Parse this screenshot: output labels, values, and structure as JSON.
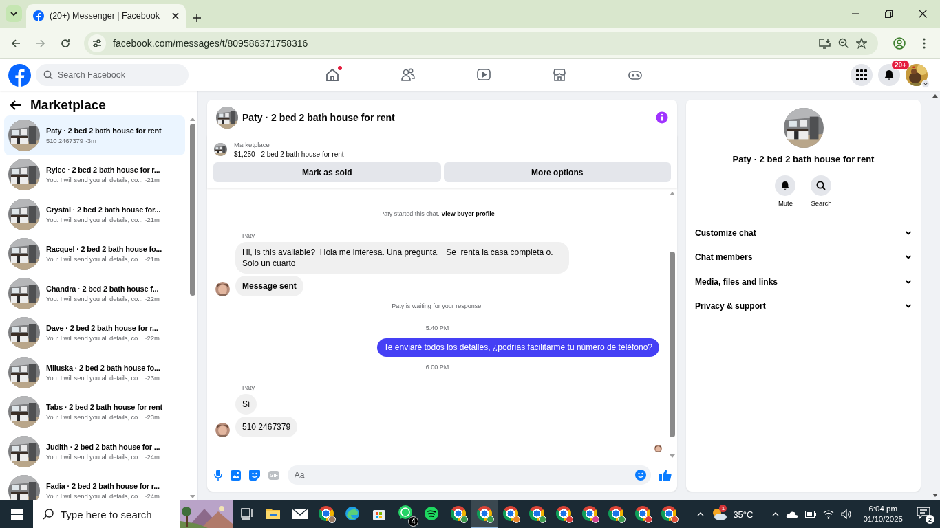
{
  "browser": {
    "tab_title": "(20+) Messenger | Facebook",
    "url": "facebook.com/messages/t/809586371758316"
  },
  "header": {
    "search_placeholder": "Search Facebook",
    "nav": [
      {
        "kind": "home",
        "dot": true
      },
      {
        "kind": "friends",
        "dot": false
      },
      {
        "kind": "video",
        "dot": false
      },
      {
        "kind": "marketplace",
        "dot": false
      },
      {
        "kind": "gaming",
        "dot": false
      }
    ],
    "notification_badge": "20+"
  },
  "sidebar": {
    "title": "Marketplace",
    "conversations": [
      {
        "title": "Paty · 2 bed 2 bath house for rent",
        "preview": "510 2467379",
        "time": "·3m",
        "selected": true
      },
      {
        "title": "Rylee · 2 bed 2 bath house for r...",
        "preview": "You: I will send you all details, co...",
        "time": "·21m",
        "selected": false
      },
      {
        "title": "Crystal · 2 bed 2 bath house for...",
        "preview": "You: I will send you all details, co...",
        "time": "·21m",
        "selected": false
      },
      {
        "title": "Racquel · 2 bed 2 bath house fo...",
        "preview": "You: I will send you all details, co...",
        "time": "·21m",
        "selected": false
      },
      {
        "title": "Chandra · 2 bed 2 bath house f...",
        "preview": "You: I will send you all details, co...",
        "time": "·22m",
        "selected": false
      },
      {
        "title": "Dave · 2 bed 2 bath house for r...",
        "preview": "You: I will send you all details, co...",
        "time": "·22m",
        "selected": false
      },
      {
        "title": "Miluska · 2 bed 2 bath house fo...",
        "preview": "You: I will send you all details, co...",
        "time": "·23m",
        "selected": false
      },
      {
        "title": "Tabs · 2 bed 2 bath house for rent",
        "preview": "You: I will send you all details, co...",
        "time": "·23m",
        "selected": false
      },
      {
        "title": "Judith · 2 bed 2 bath house for ...",
        "preview": "You: I will send you all details, co...",
        "time": "·24m",
        "selected": false
      },
      {
        "title": "Fadia · 2 bed 2 bath house for r...",
        "preview": "You: I will send you all details, co...",
        "time": "·24m",
        "selected": false
      }
    ]
  },
  "chat": {
    "title": "Paty · 2 bed 2 bath house for rent",
    "listing": {
      "label": "Marketplace",
      "line": "$1,250 - 2 bed 2 bath house for rent"
    },
    "buttons": [
      "Mark as sold",
      "More options"
    ],
    "messages": [
      {
        "kind": "system",
        "text": "Paty started this chat.",
        "link": "View buyer profile"
      },
      {
        "kind": "sender",
        "text": "Paty"
      },
      {
        "kind": "incoming",
        "text": "Hi, is this available?  Hola me interesa. Una pregunta.   Se  renta la casa completa o. Solo un cuarto",
        "avatar": false,
        "bold": false
      },
      {
        "kind": "incoming",
        "text": "Message sent",
        "avatar": true,
        "bold": true
      },
      {
        "kind": "system",
        "text": "Paty is waiting for your response."
      },
      {
        "kind": "time",
        "text": "5:40 PM"
      },
      {
        "kind": "outgoing",
        "text": "Te enviaré todos los detalles, ¿podrías facilitarme tu número de teléfono?"
      },
      {
        "kind": "time",
        "text": "6:00 PM"
      },
      {
        "kind": "sender",
        "text": "Paty"
      },
      {
        "kind": "incoming",
        "text": "Sí",
        "avatar": false,
        "bold": false
      },
      {
        "kind": "incoming",
        "text": "510 2467379",
        "avatar": true,
        "bold": false
      },
      {
        "kind": "seen"
      }
    ],
    "composer": {
      "gif_label": "GIF",
      "placeholder": "Aa"
    }
  },
  "details": {
    "title": "Paty · 2 bed 2 bath house for rent",
    "actions": [
      {
        "kind": "mute",
        "label": "Mute"
      },
      {
        "kind": "search",
        "label": "Search"
      }
    ],
    "sections": [
      {
        "label": "Customize chat",
        "expanded": false
      },
      {
        "label": "Chat members",
        "expanded": false
      },
      {
        "label": "Media, files and links",
        "expanded": false
      },
      {
        "label": "Privacy & support",
        "expanded": false
      }
    ]
  },
  "taskbar": {
    "search_placeholder": "Type here to search",
    "apps": [
      {
        "kind": "taskview",
        "active": false
      },
      {
        "kind": "explorer",
        "active": false
      },
      {
        "kind": "mail",
        "active": false
      },
      {
        "kind": "chrome",
        "color": "#9a7b63",
        "active": false
      },
      {
        "kind": "edge",
        "active": false
      },
      {
        "kind": "store",
        "active": false
      },
      {
        "kind": "whatsapp",
        "badge": "4",
        "active": false
      },
      {
        "kind": "spotify",
        "active": false
      },
      {
        "kind": "chrome",
        "color": "#3e9b4f",
        "active": false
      },
      {
        "kind": "chrome",
        "color": "#3e9b4f",
        "active": true
      },
      {
        "kind": "chrome",
        "color": "#e8842c",
        "active": false
      },
      {
        "kind": "chrome",
        "color": "#3e9b4f",
        "active": false
      },
      {
        "kind": "chrome",
        "color": "#d93a3a",
        "active": false
      },
      {
        "kind": "chrome",
        "color": "#d6408f",
        "active": false
      },
      {
        "kind": "chrome",
        "color": "#3e9b4f",
        "active": false
      },
      {
        "kind": "chrome",
        "color": "#d93a3a",
        "active": false
      },
      {
        "kind": "chrome",
        "color": "#e0523a",
        "active": false
      }
    ],
    "weather": {
      "badge": "1",
      "temp": "35°C"
    },
    "time": "6:04 pm",
    "date": "01/10/2025",
    "notifications": "2"
  }
}
